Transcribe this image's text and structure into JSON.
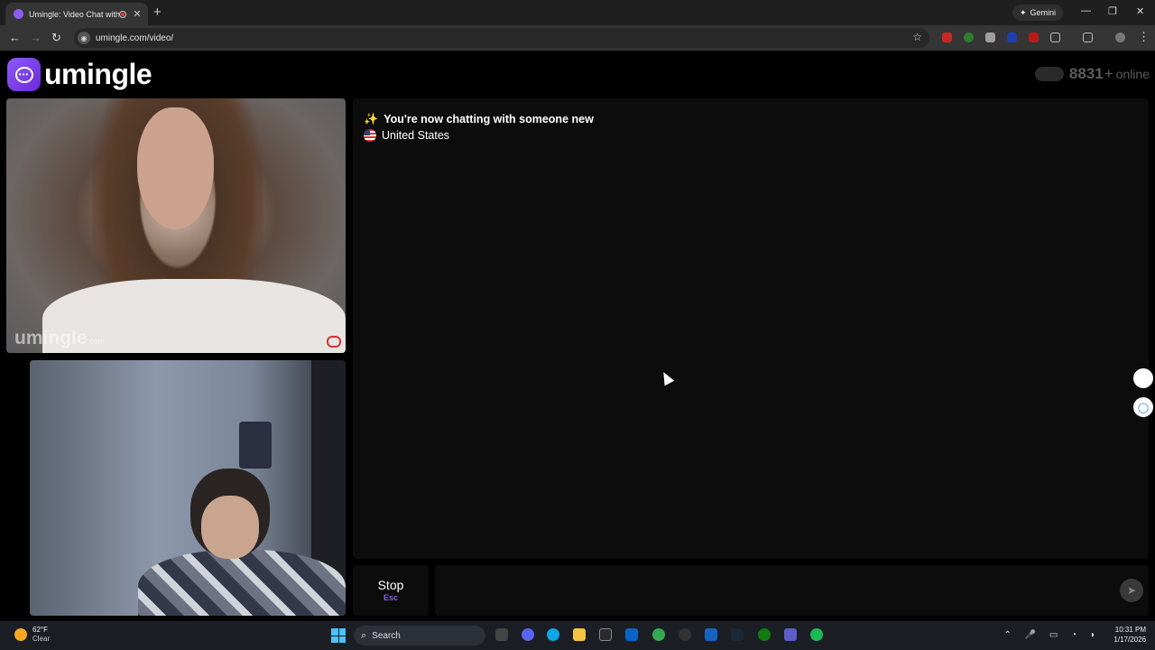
{
  "browser": {
    "tab_title": "Umingle: Video Chat with S",
    "tab_close": "✕",
    "new_tab": "+",
    "gemini_label": "Gemini",
    "url": "umingle.com/video/",
    "window_controls": [
      "—",
      "❐",
      "✕"
    ]
  },
  "site": {
    "logo_text": "umingle",
    "online_count": "8831",
    "online_plus": "+",
    "online_label": "online"
  },
  "stranger_video": {
    "watermark": "umingle",
    "watermark_suffix": ".com"
  },
  "chat": {
    "system_message": "You're now chatting with someone new",
    "location": "United States"
  },
  "controls": {
    "stop_label": "Stop",
    "stop_key": "Esc",
    "send_icon": "send-icon"
  },
  "taskbar": {
    "temperature": "62°F",
    "condition": "Clear",
    "search_label": "Search",
    "time": "10:31 PM",
    "date": "1/17/2026"
  },
  "colors": {
    "brand": "#8b5cf6",
    "chat_bg": "#0c0c0c"
  }
}
